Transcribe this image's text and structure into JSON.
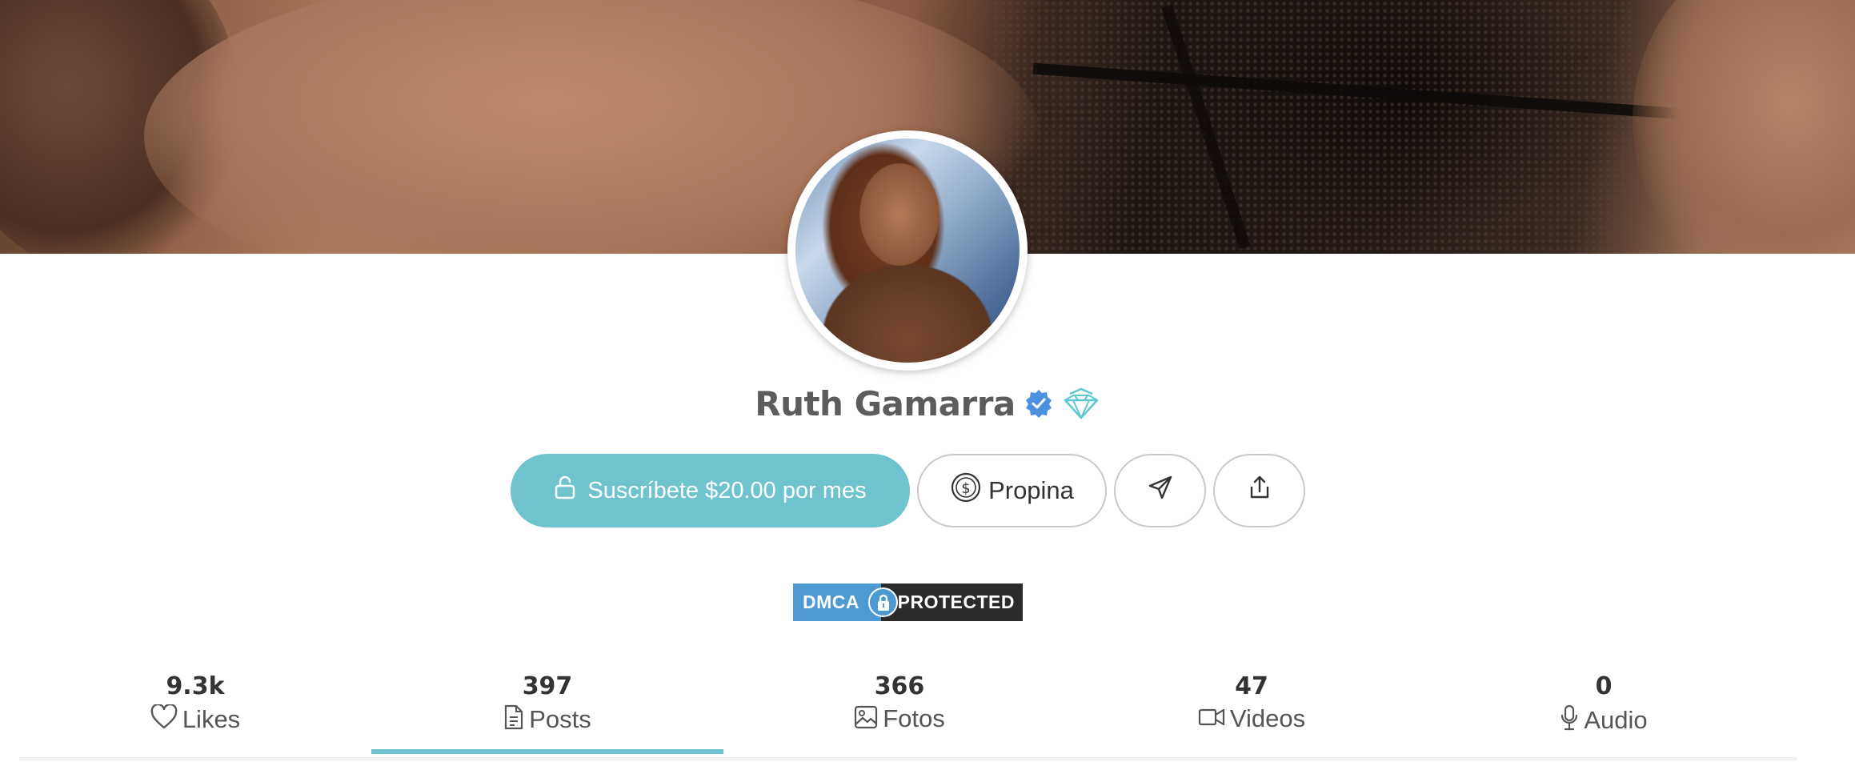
{
  "profile": {
    "name": "Ruth Gamarra",
    "verified_icon": "verified-badge-icon",
    "tier_icon": "diamond-icon"
  },
  "actions": {
    "subscribe_label": "Suscríbete $20.00 por mes",
    "subscribe_icon": "unlock-icon",
    "tip_label": "Propina",
    "tip_icon": "dollar-coin-icon",
    "message_icon": "send-icon",
    "share_icon": "share-icon"
  },
  "dmca": {
    "left": "DMCA",
    "right": "PROTECTED"
  },
  "stats": [
    {
      "count": "9.3k",
      "label": "Likes",
      "icon": "heart-icon",
      "active": false
    },
    {
      "count": "397",
      "label": "Posts",
      "icon": "document-icon",
      "active": true
    },
    {
      "count": "366",
      "label": "Fotos",
      "icon": "image-icon",
      "active": false
    },
    {
      "count": "47",
      "label": "Videos",
      "icon": "video-icon",
      "active": false
    },
    {
      "count": "0",
      "label": "Audio",
      "icon": "microphone-icon",
      "active": false
    }
  ],
  "colors": {
    "accent": "#6ec3cf",
    "verified": "#4d8fe0",
    "dmca_blue": "#4d9ad3",
    "dmca_dark": "#2b2b2b"
  }
}
